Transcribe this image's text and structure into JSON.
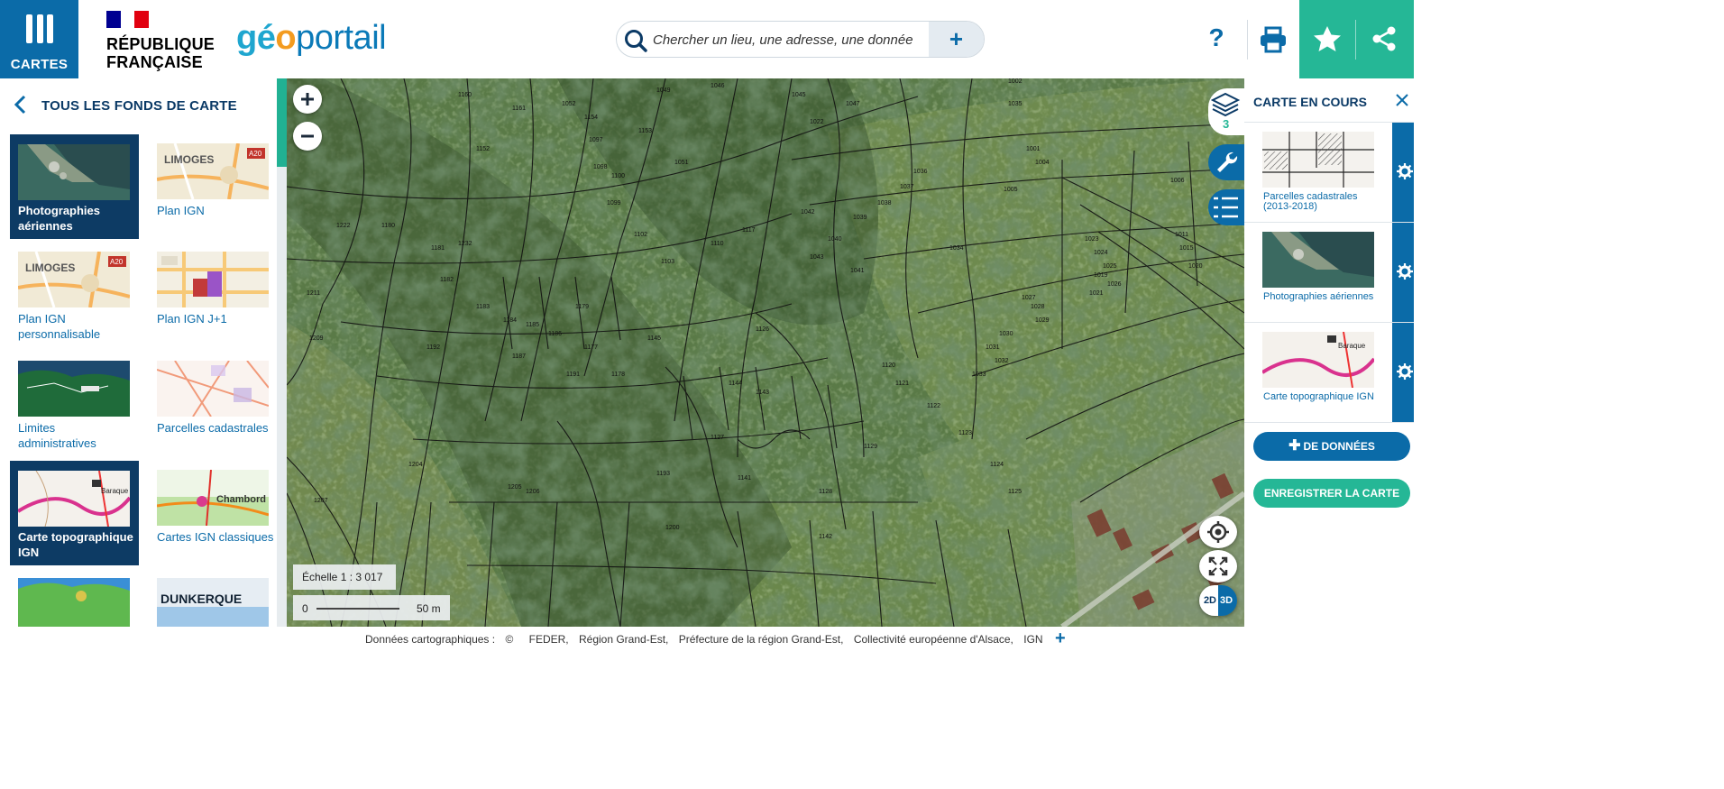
{
  "header": {
    "menu_label": "CARTES",
    "republique_line1": "RÉPUBLIQUE",
    "republique_line2": "FRANÇAISE",
    "logo_part1": "géo",
    "logo_part2": "o",
    "logo_part3": "portail",
    "search_placeholder": "Chercher un lieu, une adresse, une donnée",
    "search_plus": "+",
    "help_label": "?",
    "icons": [
      "menu-icon",
      "search-icon",
      "print-icon",
      "star-icon",
      "share-icon"
    ]
  },
  "left_panel": {
    "title": "TOUS LES FONDS DE CARTE",
    "tiles": [
      {
        "label": "Photographies aériennes",
        "selected": true,
        "thumb": "aerial"
      },
      {
        "label": "Plan IGN",
        "selected": false,
        "thumb": "plan",
        "thumb_text": "LIMOGES",
        "thumb_road": "A20"
      },
      {
        "label": "Plan IGN personnalisable",
        "selected": false,
        "thumb": "plan",
        "thumb_text": "LIMOGES",
        "thumb_road": "A20"
      },
      {
        "label": "Plan IGN J+1",
        "selected": false,
        "thumb": "planj1"
      },
      {
        "label": "Limites administratives",
        "selected": false,
        "thumb": "admin"
      },
      {
        "label": "Parcelles cadastrales",
        "selected": false,
        "thumb": "parcels"
      },
      {
        "label": "Carte topographique IGN",
        "selected": true,
        "thumb": "topo"
      },
      {
        "label": "Cartes IGN classiques",
        "selected": false,
        "thumb": "classic",
        "thumb_text": "Chambord"
      },
      {
        "label": "",
        "selected": false,
        "thumb": "relief"
      },
      {
        "label": "",
        "selected": false,
        "thumb": "dunkerque",
        "thumb_text": "DUNKERQUE"
      }
    ]
  },
  "map": {
    "zoom_in": "+",
    "zoom_out": "−",
    "scale_text": "Échelle 1 : 3 017",
    "scalebar_zero": "0",
    "scalebar_distance": "50 m",
    "btn_2d": "2D",
    "btn_3d": "3D",
    "layers_count": "3",
    "parcel_labels": [
      "1160",
      "1161",
      "1154",
      "1153",
      "1152",
      "1102",
      "1103",
      "1110",
      "1117",
      "1042",
      "1043",
      "1036",
      "1037",
      "1038",
      "1039",
      "1040",
      "1041",
      "1120",
      "1121",
      "1122",
      "1123",
      "1124",
      "1125",
      "1126",
      "1127",
      "1128",
      "1129",
      "1141",
      "1142",
      "1143",
      "1144",
      "1145",
      "1177",
      "1178",
      "1179",
      "1180",
      "1181",
      "1182",
      "1183",
      "1184",
      "1185",
      "1186",
      "1187",
      "1191",
      "1192",
      "1193",
      "1200",
      "1204",
      "1205",
      "1206",
      "1207",
      "1209",
      "1211",
      "1222",
      "1232",
      "1023",
      "1024",
      "1025",
      "1026",
      "1027",
      "1028",
      "1029",
      "1030",
      "1031",
      "1032",
      "1033",
      "1034",
      "1035",
      "1002",
      "1001",
      "1004",
      "1005",
      "1006",
      "1011",
      "1015",
      "1019",
      "1020",
      "1021",
      "1022",
      "1046",
      "1045",
      "1047",
      "1049",
      "1051",
      "1052",
      "1097",
      "1098",
      "1099",
      "1100",
      "1101"
    ]
  },
  "right_panel": {
    "title": "CARTE EN COURS",
    "layers": [
      {
        "label": "Parcelles cadastrales (2013-2018)",
        "thumb": "cadastre"
      },
      {
        "label": "Photographies aériennes",
        "thumb": "aerial"
      },
      {
        "label": "Carte topographique IGN",
        "thumb": "topo"
      }
    ],
    "add_data_label": "DE DONNÉES",
    "save_label": "ENREGISTRER LA CARTE"
  },
  "footer": {
    "credits_prefix": "Données cartographiques :",
    "copyright": "©",
    "sources": [
      "FEDER,",
      "Région Grand-Est,",
      "Préfecture de la région Grand-Est,",
      "Collectivité européenne d'Alsace,",
      "IGN"
    ],
    "expand": "+"
  },
  "colors": {
    "primary_blue": "#0b6ba8",
    "dark_blue": "#0d3b64",
    "green": "#25b796",
    "flag_blue": "#000091",
    "flag_red": "#e1000f"
  }
}
